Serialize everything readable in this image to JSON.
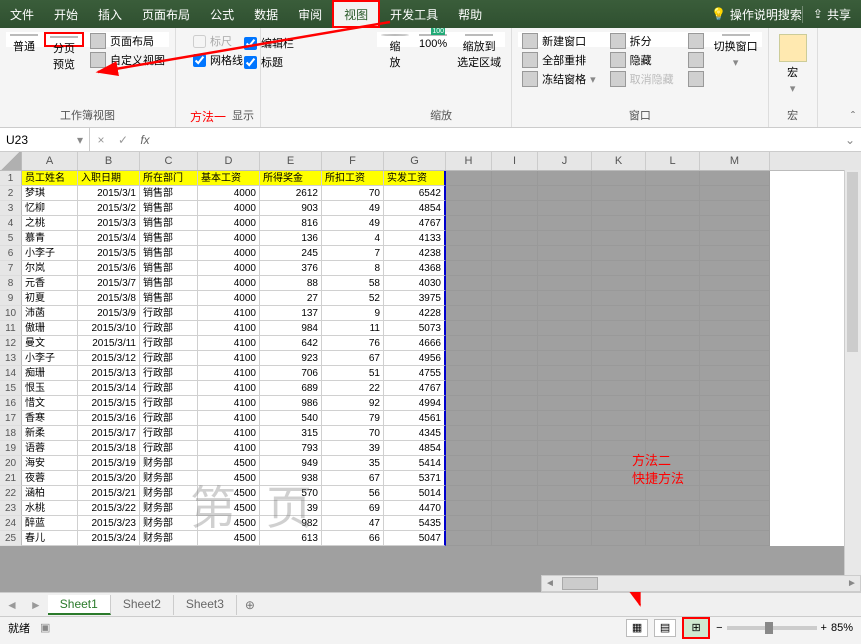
{
  "tabs": [
    "文件",
    "开始",
    "插入",
    "页面布局",
    "公式",
    "数据",
    "审阅",
    "视图",
    "开发工具",
    "帮助"
  ],
  "active_tab": "视图",
  "tell_me": "操作说明搜索",
  "share": "共享",
  "ribbon": {
    "views": {
      "normal": "普通",
      "pagebreak": "分页\n预览",
      "pagelayout": "页面布局",
      "custom": "自定义视图",
      "label": "工作簿视图"
    },
    "show": {
      "ruler": "编辑栏",
      "grid": "网格线",
      "headings": "标题",
      "label": "显示"
    },
    "zoom": {
      "zoom": "缩\n放",
      "hundred": "100%",
      "selection": "缩放到\n选定区域",
      "label": "缩放"
    },
    "window": {
      "new": "新建窗口",
      "arrange": "全部重排",
      "freeze": "冻结窗格",
      "split": "拆分",
      "hide": "隐藏",
      "unhide": "取消隐藏",
      "switch": "切换窗口",
      "label": "窗口"
    },
    "macro": {
      "macro": "宏",
      "label": "宏"
    }
  },
  "method1": "方法一",
  "method2_l1": "方法二",
  "method2_l2": "快捷方法",
  "namebox": "U23",
  "watermark": "第页",
  "columns": [
    "A",
    "B",
    "C",
    "D",
    "E",
    "F",
    "G",
    "H",
    "I",
    "J",
    "K",
    "L",
    "M"
  ],
  "colwidths": [
    "cA",
    "cB",
    "cC",
    "cD",
    "cE",
    "cF",
    "cG",
    "cH",
    "cI",
    "cJ",
    "cK",
    "cL",
    "cM"
  ],
  "headers": [
    "员工姓名",
    "入职日期",
    "所在部门",
    "基本工资",
    "所得奖金",
    "所扣工资",
    "实发工资"
  ],
  "rows": [
    [
      "梦琪",
      "2015/3/1",
      "销售部",
      "4000",
      "2612",
      "70",
      "6542"
    ],
    [
      "忆柳",
      "2015/3/2",
      "销售部",
      "4000",
      "903",
      "49",
      "4854"
    ],
    [
      "之桃",
      "2015/3/3",
      "销售部",
      "4000",
      "816",
      "49",
      "4767"
    ],
    [
      "慕青",
      "2015/3/4",
      "销售部",
      "4000",
      "136",
      "4",
      "4133"
    ],
    [
      "小李子",
      "2015/3/5",
      "销售部",
      "4000",
      "245",
      "7",
      "4238"
    ],
    [
      "尔岚",
      "2015/3/6",
      "销售部",
      "4000",
      "376",
      "8",
      "4368"
    ],
    [
      "元香",
      "2015/3/7",
      "销售部",
      "4000",
      "88",
      "58",
      "4030"
    ],
    [
      "初夏",
      "2015/3/8",
      "销售部",
      "4000",
      "27",
      "52",
      "3975"
    ],
    [
      "沛菡",
      "2015/3/9",
      "行政部",
      "4100",
      "137",
      "9",
      "4228"
    ],
    [
      "傲珊",
      "2015/3/10",
      "行政部",
      "4100",
      "984",
      "11",
      "5073"
    ],
    [
      "曼文",
      "2015/3/11",
      "行政部",
      "4100",
      "642",
      "76",
      "4666"
    ],
    [
      "小李子",
      "2015/3/12",
      "行政部",
      "4100",
      "923",
      "67",
      "4956"
    ],
    [
      "痴珊",
      "2015/3/13",
      "行政部",
      "4100",
      "706",
      "51",
      "4755"
    ],
    [
      "恨玉",
      "2015/3/14",
      "行政部",
      "4100",
      "689",
      "22",
      "4767"
    ],
    [
      "惜文",
      "2015/3/15",
      "行政部",
      "4100",
      "986",
      "92",
      "4994"
    ],
    [
      "香寒",
      "2015/3/16",
      "行政部",
      "4100",
      "540",
      "79",
      "4561"
    ],
    [
      "新柔",
      "2015/3/17",
      "行政部",
      "4100",
      "315",
      "70",
      "4345"
    ],
    [
      "语蓉",
      "2015/3/18",
      "行政部",
      "4100",
      "793",
      "39",
      "4854"
    ],
    [
      "海安",
      "2015/3/19",
      "财务部",
      "4500",
      "949",
      "35",
      "5414"
    ],
    [
      "夜蓉",
      "2015/3/20",
      "财务部",
      "4500",
      "938",
      "67",
      "5371"
    ],
    [
      "涵柏",
      "2015/3/21",
      "财务部",
      "4500",
      "570",
      "56",
      "5014"
    ],
    [
      "水桃",
      "2015/3/22",
      "财务部",
      "4500",
      "39",
      "69",
      "4470"
    ],
    [
      "醉蓝",
      "2015/3/23",
      "财务部",
      "4500",
      "982",
      "47",
      "5435"
    ],
    [
      "春儿",
      "2015/3/24",
      "财务部",
      "4500",
      "613",
      "66",
      "5047"
    ]
  ],
  "sheets": [
    "Sheet1",
    "Sheet2",
    "Sheet3"
  ],
  "active_sheet": "Sheet1",
  "status": "就绪",
  "zoom": "85%"
}
